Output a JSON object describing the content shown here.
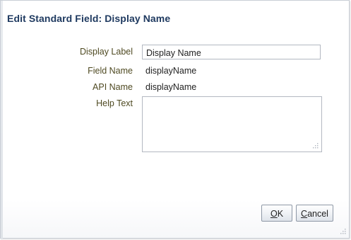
{
  "dialog": {
    "title": "Edit Standard Field: Display Name"
  },
  "form": {
    "display_label": {
      "label": "Display Label",
      "value": "Display Name"
    },
    "field_name": {
      "label": "Field Name",
      "value": "displayName"
    },
    "api_name": {
      "label": "API Name",
      "value": "displayName"
    },
    "help_text": {
      "label": "Help Text",
      "value": ""
    }
  },
  "buttons": {
    "ok": {
      "mnemonic": "O",
      "rest": "K"
    },
    "cancel": {
      "mnemonic": "C",
      "rest": "ancel"
    }
  },
  "icons": {
    "textarea_resize": "resize-grip-icon",
    "dialog_resize": "dialog-resize-grip-icon"
  }
}
